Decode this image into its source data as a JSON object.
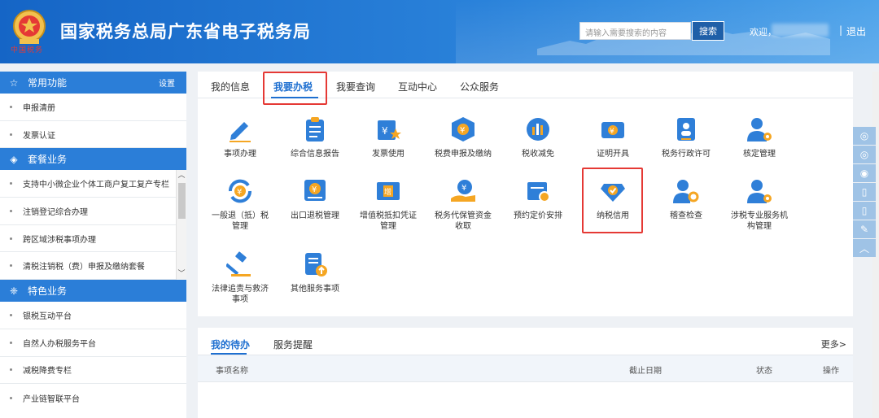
{
  "header": {
    "title": "国家税务总局广东省电子税务局",
    "emblem_text": "中国税务",
    "search_placeholder": "请输入需要搜索的内容",
    "search_button": "搜索",
    "welcome": "欢迎，",
    "separator": "|",
    "logout": "退出"
  },
  "sidebar": {
    "common": {
      "title": "常用功能",
      "settings": "设置",
      "icon": "star-icon",
      "items": [
        "申报清册",
        "发票认证"
      ]
    },
    "package": {
      "title": "套餐业务",
      "icon": "layers-icon",
      "items": [
        "支持中小微企业个体工商户复工复产专栏",
        "注销登记综合办理",
        "跨区域涉税事项办理",
        "清税注销税（费）申报及缴纳套餐"
      ]
    },
    "special": {
      "title": "特色业务",
      "icon": "grid-icon",
      "items": [
        "银税互动平台",
        "自然人办税服务平台",
        "减税降费专栏",
        "产业链智联平台"
      ]
    }
  },
  "tabs": [
    "我的信息",
    "我要办税",
    "我要查询",
    "互动中心",
    "公众服务"
  ],
  "active_tab": "我要办税",
  "services": {
    "row1": [
      "事项办理",
      "综合信息报告",
      "发票使用",
      "税费申报及缴纳",
      "税收减免",
      "证明开具",
      "税务行政许可",
      "核定管理"
    ],
    "row2": [
      {
        "l1": "一般退（抵）税",
        "l2": "管理"
      },
      {
        "l1": "出口退税管理",
        "l2": ""
      },
      {
        "l1": "增值税抵扣凭证",
        "l2": "管理"
      },
      {
        "l1": "税务代保管资金",
        "l2": "收取"
      },
      {
        "l1": "预约定价安排",
        "l2": ""
      },
      {
        "l1": "纳税信用",
        "l2": ""
      },
      {
        "l1": "稽查检查",
        "l2": ""
      },
      {
        "l1": "涉税专业服务机",
        "l2": "构管理"
      }
    ],
    "row3": [
      {
        "l1": "法律追责与救济",
        "l2": "事项"
      },
      {
        "l1": "其他服务事项",
        "l2": ""
      }
    ]
  },
  "todo": {
    "tabs": [
      "我的待办",
      "服务提醒"
    ],
    "more": "更多>",
    "columns": [
      "事项名称",
      "截止日期",
      "状态",
      "操作"
    ]
  },
  "colors": {
    "header_blue": "#1565c6",
    "accent_blue": "#1e6fd0",
    "highlight_red": "#e53935",
    "icon_orange": "#f5a623"
  }
}
